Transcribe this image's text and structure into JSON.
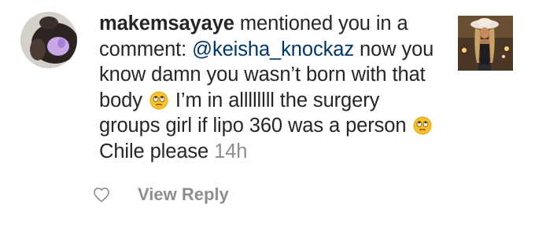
{
  "notification": {
    "username": "makemsayaye",
    "action_text": "mentioned you in a comment:",
    "mention": "@keisha_knockaz",
    "comment_part1": "now you know damn you wasn’t born with that body",
    "comment_part2": "I’m in allllllll the surgery groups girl if lipo 360 was a person",
    "comment_part3": "Chile please",
    "timestamp": "14h",
    "emoji": "rolling-eyes-emoji"
  },
  "actions": {
    "like_icon": "heart-outline-icon",
    "reply_label": "View Reply"
  },
  "colors": {
    "text": "#262626",
    "mention": "#00376b",
    "muted": "#8e8e8e"
  }
}
